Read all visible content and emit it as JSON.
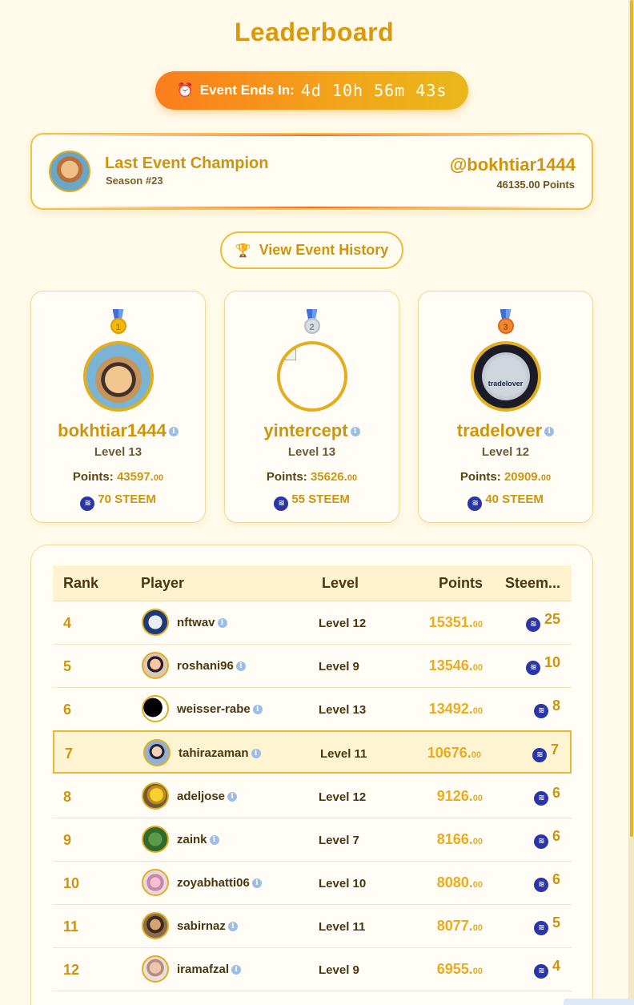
{
  "title": "Leaderboard",
  "countdown": {
    "label": "Event Ends In:",
    "time": "4d 10h 56m 43s",
    "icon": "alarm-clock-icon"
  },
  "champion": {
    "title": "Last Event Champion",
    "season": "Season #23",
    "username": "@bokhtiar1444",
    "points": "46135.00 Points"
  },
  "history_button": {
    "label": "View Event History",
    "icon": "trophy-icon"
  },
  "podium": [
    {
      "medal": "1",
      "name": "bokhtiar1444",
      "level": "Level 13",
      "points_label": "Points:",
      "points": "43597.",
      "points_dec": "00",
      "steem": "70 STEEM"
    },
    {
      "medal": "2",
      "name": "yintercept",
      "level": "Level 13",
      "points_label": "Points:",
      "points": "35626.",
      "points_dec": "00",
      "steem": "55 STEEM"
    },
    {
      "medal": "3",
      "name": "tradelover",
      "level": "Level 12",
      "points_label": "Points:",
      "points": "20909.",
      "points_dec": "00",
      "steem": "40 STEEM"
    }
  ],
  "podium_logo_text": "tradelover",
  "table": {
    "headers": {
      "rank": "Rank",
      "player": "Player",
      "level": "Level",
      "points": "Points",
      "steem": "Steem..."
    },
    "rows": [
      {
        "rank": "4",
        "player": "nftwav",
        "level": "Level 12",
        "points": "15351.",
        "dec": "00",
        "steem": "25"
      },
      {
        "rank": "5",
        "player": "roshani96",
        "level": "Level 9",
        "points": "13546.",
        "dec": "00",
        "steem": "10"
      },
      {
        "rank": "6",
        "player": "weisser-rabe",
        "level": "Level 13",
        "points": "13492.",
        "dec": "00",
        "steem": "8"
      },
      {
        "rank": "7",
        "player": "tahirazaman",
        "level": "Level 11",
        "points": "10676.",
        "dec": "00",
        "steem": "7"
      },
      {
        "rank": "8",
        "player": "adeljose",
        "level": "Level 12",
        "points": "9126.",
        "dec": "00",
        "steem": "6"
      },
      {
        "rank": "9",
        "player": "zaink",
        "level": "Level 7",
        "points": "8166.",
        "dec": "00",
        "steem": "6"
      },
      {
        "rank": "10",
        "player": "zoyabhatti06",
        "level": "Level 10",
        "points": "8080.",
        "dec": "00",
        "steem": "6"
      },
      {
        "rank": "11",
        "player": "sabirnaz",
        "level": "Level 11",
        "points": "8077.",
        "dec": "00",
        "steem": "5"
      },
      {
        "rank": "12",
        "player": "iramafzal",
        "level": "Level 9",
        "points": "6955.",
        "dec": "00",
        "steem": "4"
      }
    ]
  },
  "colors": {
    "accent": "#cf940d",
    "gold": "#e2ad1e",
    "background": "#fffaea",
    "steem": "#2a36a8"
  }
}
